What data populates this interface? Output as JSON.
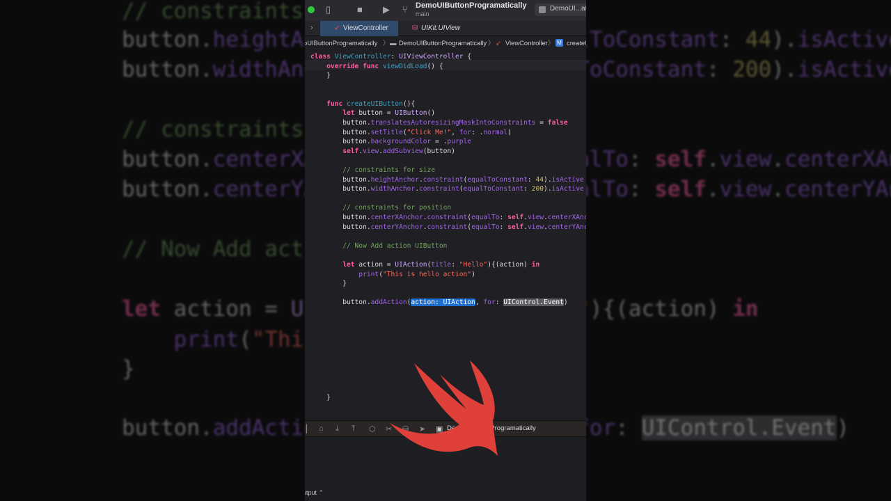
{
  "toolbar": {
    "scheme": "DemoUIButtonProgramatically",
    "branch": "main",
    "destination": "DemoUI...atic"
  },
  "tabs": [
    {
      "label": "ViewController"
    },
    {
      "label": "UIKit.UIView"
    }
  ],
  "breadcrumb": [
    "oUIButtonProgramatically",
    "DemoUIButtonProgramatically",
    "ViewController",
    "createU"
  ],
  "code": [
    [
      [
        "class ",
        "kw"
      ],
      [
        "ViewController",
        "decl"
      ],
      [
        ": ",
        "pl"
      ],
      [
        "UIViewController",
        "typ"
      ],
      [
        " {",
        "pl"
      ]
    ],
    [
      [
        "    override func ",
        "kw"
      ],
      [
        "viewDidLoad",
        "decl"
      ],
      [
        "() {",
        "pl"
      ]
    ],
    [
      [
        "    }",
        "pl"
      ]
    ],
    [
      [
        "    func ",
        "kw"
      ],
      [
        "createUIButton",
        "decl"
      ],
      [
        "(){",
        "pl"
      ]
    ],
    [
      [
        "        let ",
        "kw"
      ],
      [
        "button = ",
        "pl"
      ],
      [
        "UIButton",
        "typ"
      ],
      [
        "()",
        "pl"
      ]
    ],
    [
      [
        "        button.",
        "pl"
      ],
      [
        "translatesAutoresizingMaskIntoConstraints",
        "meth"
      ],
      [
        " = ",
        "pl"
      ],
      [
        "false",
        "kw"
      ]
    ],
    [
      [
        "        button.",
        "pl"
      ],
      [
        "setTitle",
        "meth"
      ],
      [
        "(",
        "pl"
      ],
      [
        "\"Click Me!\"",
        "str"
      ],
      [
        ", ",
        "pl"
      ],
      [
        "for",
        "meth"
      ],
      [
        ": .",
        "pl"
      ],
      [
        "normal",
        "meth"
      ],
      [
        ")",
        "pl"
      ]
    ],
    [
      [
        "        button.",
        "pl"
      ],
      [
        "backgroundColor",
        "meth"
      ],
      [
        " = .",
        "pl"
      ],
      [
        "purple",
        "meth"
      ]
    ],
    [
      [
        "        self",
        "kw"
      ],
      [
        ".",
        "pl"
      ],
      [
        "view",
        "meth"
      ],
      [
        ".",
        "pl"
      ],
      [
        "addSubview",
        "meth"
      ],
      [
        "(button)",
        "pl"
      ]
    ],
    [
      [
        "        // constraints for size",
        "cmt"
      ]
    ],
    [
      [
        "        button.",
        "pl"
      ],
      [
        "heightAnchor",
        "meth"
      ],
      [
        ".",
        "pl"
      ],
      [
        "constraint",
        "meth"
      ],
      [
        "(",
        "pl"
      ],
      [
        "equalToConstant",
        "meth"
      ],
      [
        ": ",
        "pl"
      ],
      [
        "44",
        "num"
      ],
      [
        ").",
        "pl"
      ],
      [
        "isActive",
        "meth"
      ]
    ],
    [
      [
        "        button.",
        "pl"
      ],
      [
        "widthAnchor",
        "meth"
      ],
      [
        ".",
        "pl"
      ],
      [
        "constraint",
        "meth"
      ],
      [
        "(",
        "pl"
      ],
      [
        "equalToConstant",
        "meth"
      ],
      [
        ": ",
        "pl"
      ],
      [
        "200",
        "num"
      ],
      [
        ").",
        "pl"
      ],
      [
        "isActive",
        "meth"
      ]
    ],
    [
      [
        "        // constraints for position",
        "cmt"
      ]
    ],
    [
      [
        "        button.",
        "pl"
      ],
      [
        "centerXAnchor",
        "meth"
      ],
      [
        ".",
        "pl"
      ],
      [
        "constraint",
        "meth"
      ],
      [
        "(",
        "pl"
      ],
      [
        "equalTo",
        "meth"
      ],
      [
        ": ",
        "pl"
      ],
      [
        "self",
        "kw"
      ],
      [
        ".",
        "pl"
      ],
      [
        "view",
        "meth"
      ],
      [
        ".",
        "pl"
      ],
      [
        "centerXAnchor",
        "meth"
      ]
    ],
    [
      [
        "        button.",
        "pl"
      ],
      [
        "centerYAnchor",
        "meth"
      ],
      [
        ".",
        "pl"
      ],
      [
        "constraint",
        "meth"
      ],
      [
        "(",
        "pl"
      ],
      [
        "equalTo",
        "meth"
      ],
      [
        ": ",
        "pl"
      ],
      [
        "self",
        "kw"
      ],
      [
        ".",
        "pl"
      ],
      [
        "view",
        "meth"
      ],
      [
        ".",
        "pl"
      ],
      [
        "centerYAnchor",
        "meth"
      ]
    ],
    [
      [
        "        // Now Add action UIButton",
        "cmt"
      ]
    ],
    [
      [
        "        let ",
        "kw"
      ],
      [
        "action = ",
        "pl"
      ],
      [
        "UIAction",
        "typ"
      ],
      [
        "(",
        "pl"
      ],
      [
        "title",
        "meth"
      ],
      [
        ": ",
        "pl"
      ],
      [
        "\"Hello\"",
        "str"
      ],
      [
        "){(action) ",
        "pl"
      ],
      [
        "in",
        "kw"
      ]
    ],
    [
      [
        "            print",
        "meth"
      ],
      [
        "(",
        "pl"
      ],
      [
        "\"This is hello action\"",
        "str"
      ],
      [
        ")",
        "pl"
      ]
    ],
    [
      [
        "        }",
        "pl"
      ]
    ],
    [
      [
        "        button.",
        "pl"
      ],
      [
        "addAction",
        "meth"
      ],
      [
        "(",
        "pl"
      ],
      [
        "action: UIAction",
        "hl1"
      ],
      [
        ", ",
        "pl"
      ],
      [
        "for",
        "meth"
      ],
      [
        ": ",
        "pl"
      ],
      [
        "UIControl.Event",
        "hl2"
      ],
      [
        ")",
        "pl"
      ]
    ],
    [
      [
        "    }",
        "pl"
      ]
    ]
  ],
  "bg_code": [
    [
      [
        "// constraints for size",
        "cmt"
      ]
    ],
    [
      [
        "button.",
        "pl"
      ],
      [
        "heightAnchor",
        "meth"
      ],
      [
        ".",
        "pl"
      ],
      [
        "constraint",
        "meth"
      ],
      [
        "(",
        "pl"
      ],
      [
        "equalToConstant",
        "meth"
      ],
      [
        ": ",
        "pl"
      ],
      [
        "44",
        "num"
      ],
      [
        ").",
        "pl"
      ],
      [
        "isActive",
        "meth"
      ]
    ],
    [
      [
        "button.",
        "pl"
      ],
      [
        "widthAnchor",
        "meth"
      ],
      [
        ".",
        "pl"
      ],
      [
        "constraint",
        "meth"
      ],
      [
        "(",
        "pl"
      ],
      [
        "equalToConstant",
        "meth"
      ],
      [
        ": ",
        "pl"
      ],
      [
        "200",
        "num"
      ],
      [
        ").",
        "pl"
      ],
      [
        "isActive",
        "meth"
      ]
    ],
    [
      [
        "// constraints for position",
        "cmt"
      ]
    ],
    [
      [
        "button.",
        "pl"
      ],
      [
        "centerXAnchor",
        "meth"
      ],
      [
        ".",
        "pl"
      ],
      [
        "constraint",
        "meth"
      ],
      [
        "(",
        "pl"
      ],
      [
        "equalTo",
        "meth"
      ],
      [
        ": ",
        "pl"
      ],
      [
        "self",
        "kw"
      ],
      [
        ".",
        "pl"
      ],
      [
        "view",
        "meth"
      ],
      [
        ".",
        "pl"
      ],
      [
        "centerXAnchor",
        "meth"
      ]
    ],
    [
      [
        "button.",
        "pl"
      ],
      [
        "centerYAnchor",
        "meth"
      ],
      [
        ".",
        "pl"
      ],
      [
        "constraint",
        "meth"
      ],
      [
        "(",
        "pl"
      ],
      [
        "equalTo",
        "meth"
      ],
      [
        ": ",
        "pl"
      ],
      [
        "self",
        "kw"
      ],
      [
        ".",
        "pl"
      ],
      [
        "view",
        "meth"
      ],
      [
        ".",
        "pl"
      ],
      [
        "centerYAnchor",
        "meth"
      ]
    ],
    [
      [
        "// Now Add action UIButton",
        "cmt"
      ]
    ],
    [
      [
        "let ",
        "kw"
      ],
      [
        "action = ",
        "pl"
      ],
      [
        "UIAction",
        "typ"
      ],
      [
        "(",
        "pl"
      ],
      [
        "title",
        "meth"
      ],
      [
        ": ",
        "pl"
      ],
      [
        "\"Hello\"",
        "str"
      ],
      [
        "){(action) ",
        "pl"
      ],
      [
        "in",
        "kw"
      ]
    ],
    [
      [
        "    print",
        "meth"
      ],
      [
        "(",
        "pl"
      ],
      [
        "\"This is hello action\"",
        "str"
      ],
      [
        ")",
        "pl"
      ]
    ],
    [
      [
        "}",
        "pl"
      ]
    ],
    [
      [
        "button.",
        "pl"
      ],
      [
        "addAction",
        "meth"
      ],
      [
        "(",
        "pl"
      ],
      [
        "action: UIAction",
        "pl"
      ],
      [
        ", ",
        "pl"
      ],
      [
        "for",
        "meth"
      ],
      [
        ": ",
        "pl"
      ],
      [
        "UIControl.Event",
        "hl2"
      ],
      [
        ")",
        "pl"
      ]
    ]
  ],
  "debug": {
    "target": "DemoUIButtonProgramatically",
    "output_label": "Output ⌃"
  },
  "colors": {
    "swift_logo": "#e0403a",
    "active_tab": "#2f4a6a",
    "selection": "#1f6fd0"
  }
}
